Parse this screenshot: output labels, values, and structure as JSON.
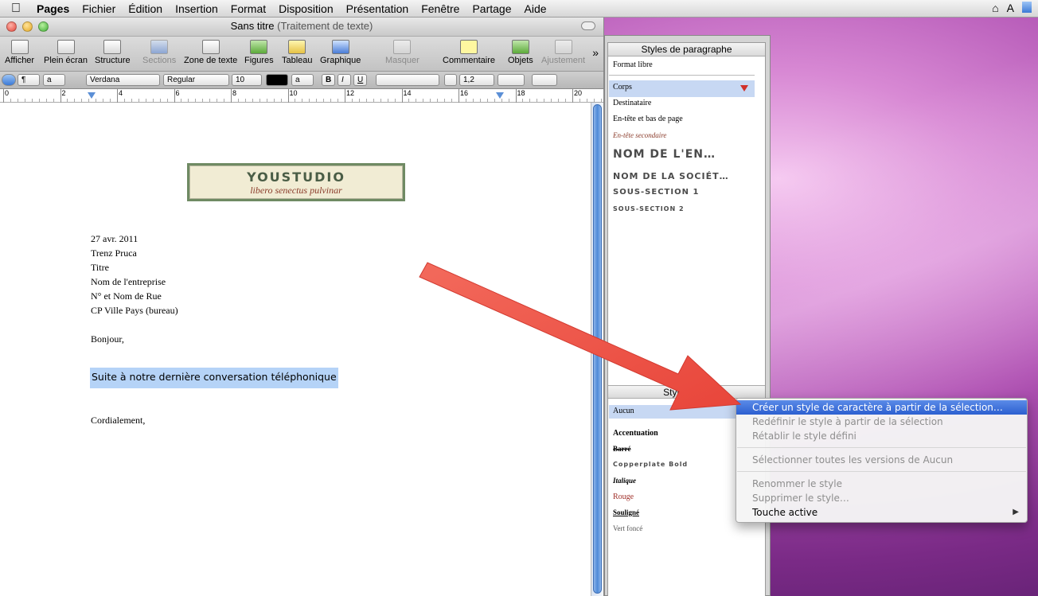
{
  "menubar": {
    "app_name": "Pages",
    "items": [
      "Fichier",
      "Édition",
      "Insertion",
      "Format",
      "Disposition",
      "Présentation",
      "Fenêtre",
      "Partage",
      "Aide"
    ]
  },
  "window": {
    "title": "Sans titre",
    "subtitle": "(Traitement de texte)"
  },
  "toolbar": {
    "buttons": [
      {
        "label": "Afficher"
      },
      {
        "label": "Plein écran"
      },
      {
        "label": "Structure"
      },
      {
        "label": "Sections"
      },
      {
        "label": "Zone de texte"
      },
      {
        "label": "Figures"
      },
      {
        "label": "Tableau"
      },
      {
        "label": "Graphique"
      },
      {
        "label": "Masquer"
      },
      {
        "label": "Commentaire"
      },
      {
        "label": "Objets"
      },
      {
        "label": "Ajustement"
      }
    ],
    "more": "»"
  },
  "formatbar": {
    "paragraph_marker": "¶",
    "char_marker": "a",
    "font": "Verdana",
    "typeface": "Regular",
    "size": "10",
    "text_color": "a",
    "bold": "B",
    "italic": "I",
    "underline": "U",
    "line_spacing": "1,2"
  },
  "ruler": {
    "labels": [
      "0",
      "2",
      "4",
      "6",
      "8",
      "10",
      "12",
      "14",
      "16",
      "18",
      "20"
    ]
  },
  "document": {
    "logo_brand": "YOUSTUDIO",
    "logo_tagline": "libero senectus pulvinar",
    "address_lines": [
      "27 avr. 2011",
      "Trenz Pruca",
      "Titre",
      "Nom de l'entreprise",
      "N° et Nom de Rue",
      "CP Ville Pays (bureau)"
    ],
    "greeting": "Bonjour,",
    "selected_text": "Suite à notre dernière conversation téléphonique",
    "closing": "Cordialement,"
  },
  "paragraph_styles": {
    "header": "Styles de paragraphe",
    "items": [
      "Format libre",
      "Corps",
      "Destinataire",
      "En-tête et bas de page",
      "En-tête secondaire",
      "NOM DE L'EN…",
      "NOM DE LA SOCIÉT…",
      "SOUS-SECTION 1",
      "SOUS-SECTION 2"
    ]
  },
  "char_styles": {
    "header": "Styles de c",
    "items": [
      "Aucun",
      "Accentuation",
      "Barré",
      "Copperplate Bold",
      "Italique",
      "Rouge",
      "Souligné",
      "Vert foncé"
    ]
  },
  "context_menu": {
    "items": [
      "Créer un style de caractère à partir de la sélection…",
      "Redéfinir le style à partir de la sélection",
      "Rétablir le style défini",
      "Sélectionner toutes les versions de Aucun",
      "Renommer le style",
      "Supprimer le style…",
      "Touche active"
    ],
    "submenu_arrow": "▶"
  },
  "colors": {
    "selection": "#b5d3f7",
    "menu_highlight": "#2c5fd0",
    "arrow": "#f0574a",
    "logo_border": "#6f8a63"
  }
}
